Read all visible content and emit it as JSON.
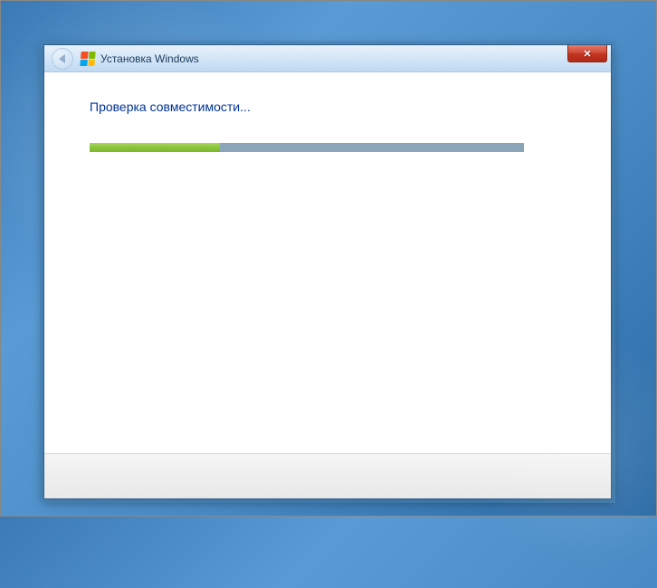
{
  "window": {
    "title": "Установка Windows"
  },
  "content": {
    "heading": "Проверка совместимости..."
  },
  "progress": {
    "percent": 30
  }
}
